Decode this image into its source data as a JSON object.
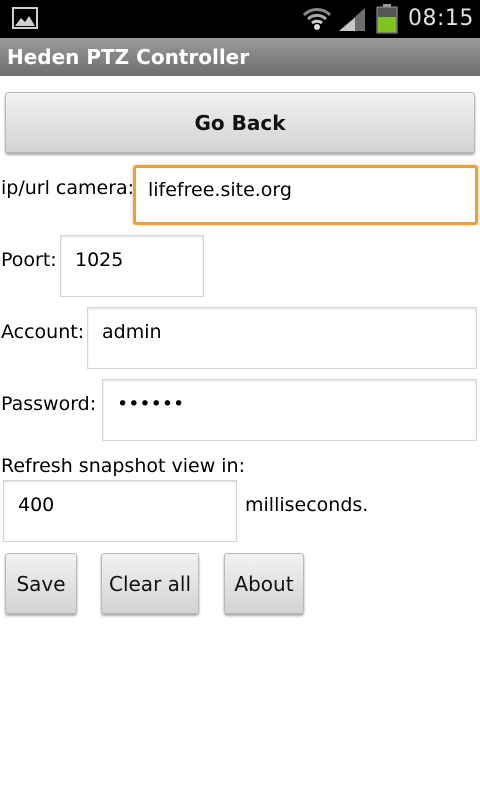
{
  "status_bar": {
    "time": "08:15",
    "icons": [
      "gallery-icon",
      "wifi-icon",
      "signal-icon",
      "battery-icon"
    ],
    "battery_color": "#7fc31c"
  },
  "app": {
    "title": "Heden PTZ Controller"
  },
  "buttons": {
    "go_back": "Go Back",
    "save": "Save",
    "clear_all": "Clear all",
    "about": "About"
  },
  "form": {
    "camera_label": "ip/url camera:",
    "camera_value": "lifefree.site.org",
    "port_label": "Poort:",
    "port_value": "1025",
    "account_label": "Account:",
    "account_value": "admin",
    "password_label": "Password:",
    "password_value": "••••••",
    "refresh_label": "Refresh snapshot view in:",
    "refresh_value": "400",
    "refresh_unit": "milliseconds."
  },
  "colors": {
    "focus_border": "#f0a030",
    "title_bar": "#8a8a8a"
  }
}
